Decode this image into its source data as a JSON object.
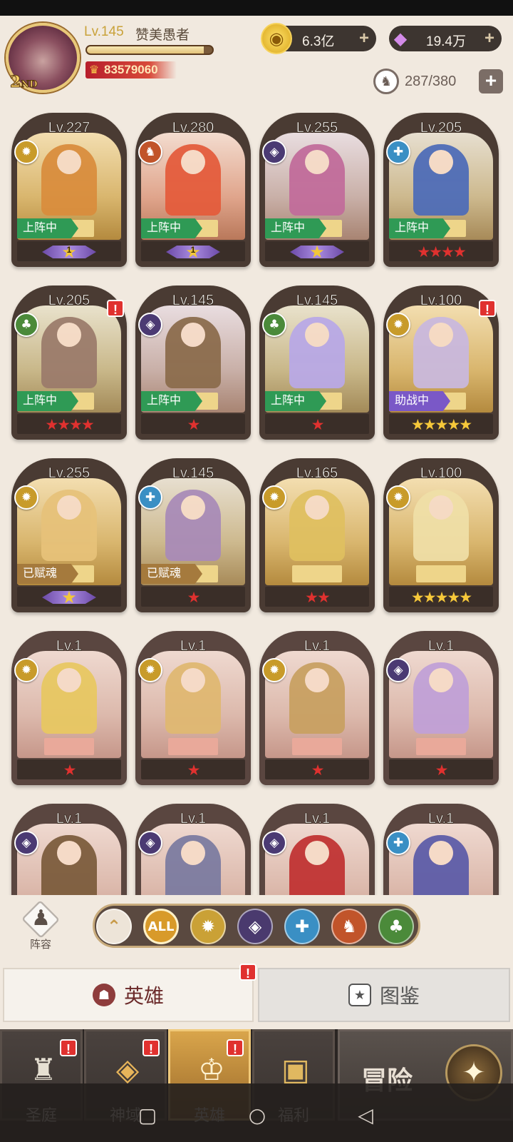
{
  "player": {
    "level": "Lv.145",
    "name": "赞美愚者",
    "rank": "2",
    "rank_suffix": "ND",
    "power": "83579060",
    "xp_fraction": 0.93
  },
  "resources": {
    "gold": "6.3亿",
    "diamonds": "19.4万",
    "hero_slots": "287/380"
  },
  "heroes": [
    {
      "level": "Lv.227",
      "faction": "light",
      "status": "上阵中",
      "stars": 1,
      "star_type": "purple-wing",
      "star_label": "1",
      "alert": false
    },
    {
      "level": "Lv.280",
      "faction": "beast",
      "status": "上阵中",
      "stars": 1,
      "star_type": "purple-wing",
      "star_label": "1",
      "alert": false
    },
    {
      "level": "Lv.255",
      "faction": "dark",
      "status": "上阵中",
      "stars": 1,
      "star_type": "purple-wing",
      "star_label": "",
      "alert": false
    },
    {
      "level": "Lv.205",
      "faction": "holy",
      "status": "上阵中",
      "stars": 4,
      "star_type": "red",
      "star_label": "",
      "alert": false
    },
    {
      "level": "Lv.205",
      "faction": "nature",
      "status": "上阵中",
      "stars": 4,
      "star_type": "red",
      "star_label": "",
      "alert": true
    },
    {
      "level": "Lv.145",
      "faction": "dark",
      "status": "上阵中",
      "stars": 1,
      "star_type": "red",
      "star_label": "",
      "alert": false
    },
    {
      "level": "Lv.145",
      "faction": "nature",
      "status": "上阵中",
      "stars": 1,
      "star_type": "red",
      "star_label": "",
      "alert": false
    },
    {
      "level": "Lv.100",
      "faction": "light",
      "status": "助战中",
      "stars": 5,
      "star_type": "gold",
      "star_label": "",
      "alert": true
    },
    {
      "level": "Lv.255",
      "faction": "light",
      "status": "已赋魂",
      "stars": 1,
      "star_type": "purple-wing",
      "star_label": "",
      "alert": false
    },
    {
      "level": "Lv.145",
      "faction": "holy",
      "status": "已赋魂",
      "stars": 1,
      "star_type": "red",
      "star_label": "",
      "alert": false
    },
    {
      "level": "Lv.165",
      "faction": "light",
      "status": "",
      "stars": 2,
      "star_type": "red",
      "star_label": "",
      "alert": false
    },
    {
      "level": "Lv.100",
      "faction": "light",
      "status": "",
      "stars": 5,
      "star_type": "gold",
      "star_label": "",
      "alert": false
    },
    {
      "level": "Lv.1",
      "faction": "light",
      "status": "",
      "stars": 1,
      "star_type": "red",
      "star_label": "",
      "alert": false
    },
    {
      "level": "Lv.1",
      "faction": "light",
      "status": "",
      "stars": 1,
      "star_type": "red",
      "star_label": "",
      "alert": false
    },
    {
      "level": "Lv.1",
      "faction": "light",
      "status": "",
      "stars": 1,
      "star_type": "red",
      "star_label": "",
      "alert": false
    },
    {
      "level": "Lv.1",
      "faction": "dark",
      "status": "",
      "stars": 1,
      "star_type": "red",
      "star_label": "",
      "alert": false
    },
    {
      "level": "Lv.1",
      "faction": "dark",
      "status": "",
      "stars": 0,
      "star_type": "red",
      "star_label": "",
      "alert": false
    },
    {
      "level": "Lv.1",
      "faction": "dark",
      "status": "",
      "stars": 0,
      "star_type": "red",
      "star_label": "",
      "alert": false
    },
    {
      "level": "Lv.1",
      "faction": "dark",
      "status": "",
      "stars": 0,
      "star_type": "red",
      "star_label": "",
      "alert": false
    },
    {
      "level": "Lv.1",
      "faction": "holy",
      "status": "",
      "stars": 0,
      "star_type": "red",
      "star_label": "",
      "alert": false
    }
  ],
  "filters": {
    "lineup_label": "阵容",
    "items": [
      {
        "name": "sort",
        "label": "",
        "color": "#ede4d8"
      },
      {
        "name": "all",
        "label": "ALL",
        "color": "#d89a2a"
      },
      {
        "name": "light",
        "label": "",
        "color": "#caa136"
      },
      {
        "name": "dark",
        "label": "",
        "color": "#4a3a6e"
      },
      {
        "name": "holy",
        "label": "",
        "color": "#3a8fc4"
      },
      {
        "name": "beast",
        "label": "",
        "color": "#c1542a"
      },
      {
        "name": "nature",
        "label": "",
        "color": "#4b8a3a"
      }
    ]
  },
  "tabs": {
    "heroes": "英雄",
    "codex": "图鉴"
  },
  "nav": {
    "sanctuary": "圣庭",
    "divine": "神域",
    "heroes": "英雄",
    "welfare": "福利",
    "adventure": "冒险"
  },
  "colors": {
    "on_duty": "#2f9a55",
    "support": "#7a58c7",
    "soul": "#a57a3d",
    "alert": "#e0312f"
  }
}
